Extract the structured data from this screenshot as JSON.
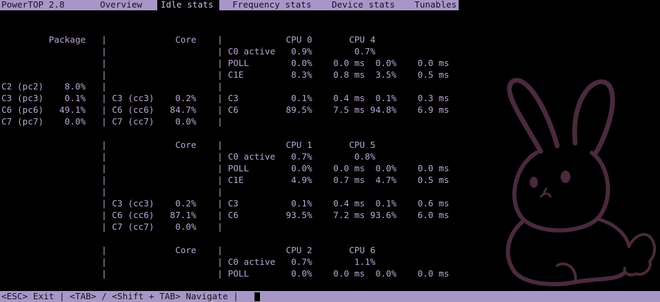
{
  "app": {
    "title": "PowerTOP 2.8"
  },
  "tabs": [
    {
      "label": "Overview",
      "active": false
    },
    {
      "label": "Idle stats",
      "active": true
    },
    {
      "label": "Frequency stats",
      "active": false
    },
    {
      "label": "Device stats",
      "active": false
    },
    {
      "label": "Tunables",
      "active": false
    }
  ],
  "lines": [
    "",
    "",
    "         Package   |             Core    |            CPU 0       CPU 4",
    "                   |                     | C0 active   0.9%        0.7%",
    "                   |                     | POLL        0.0%    0.0 ms  0.0%    0.0 ms",
    "                   |                     | C1E         8.3%    0.8 ms  3.5%    0.5 ms",
    "C2 (pc2)    8.0%   |                     |",
    "C3 (pc3)    0.1%   | C3 (cc3)    0.2%    | C3          0.1%    0.4 ms  0.1%    0.3 ms",
    "C6 (pc6)   49.1%   | C6 (cc6)   84.7%    | C6         89.5%    7.5 ms 94.8%    6.9 ms",
    "C7 (pc7)    0.0%   | C7 (cc7)    0.0%    |",
    "",
    "                   |             Core    |            CPU 1       CPU 5",
    "                   |                     | C0 active   0.7%        0.8%",
    "                   |                     | POLL        0.0%    0.0 ms  0.0%    0.0 ms",
    "                   |                     | C1E         4.9%    0.7 ms  4.7%    0.5 ms",
    "                   |                     |",
    "                   | C3 (cc3)    0.2%    | C3          0.1%    0.4 ms  0.1%    0.6 ms",
    "                   | C6 (cc6)   87.1%    | C6         93.5%    7.2 ms 93.6%    6.0 ms",
    "                   | C7 (cc7)    0.0%    |",
    "",
    "                   |             Core    |            CPU 2       CPU 6",
    "                   |                     | C0 active   0.7%        1.1%",
    "                   |                     | POLL        0.0%    0.0 ms  0.0%    0.0 ms"
  ],
  "status_bar": {
    "text": "<ESC> Exit | <TAB> / <Shift + TAB> Navigate |"
  },
  "colors": {
    "bar_background": "#a896c8",
    "text": "#b8a6d2",
    "bunny_outline": "#4a2a3c"
  }
}
